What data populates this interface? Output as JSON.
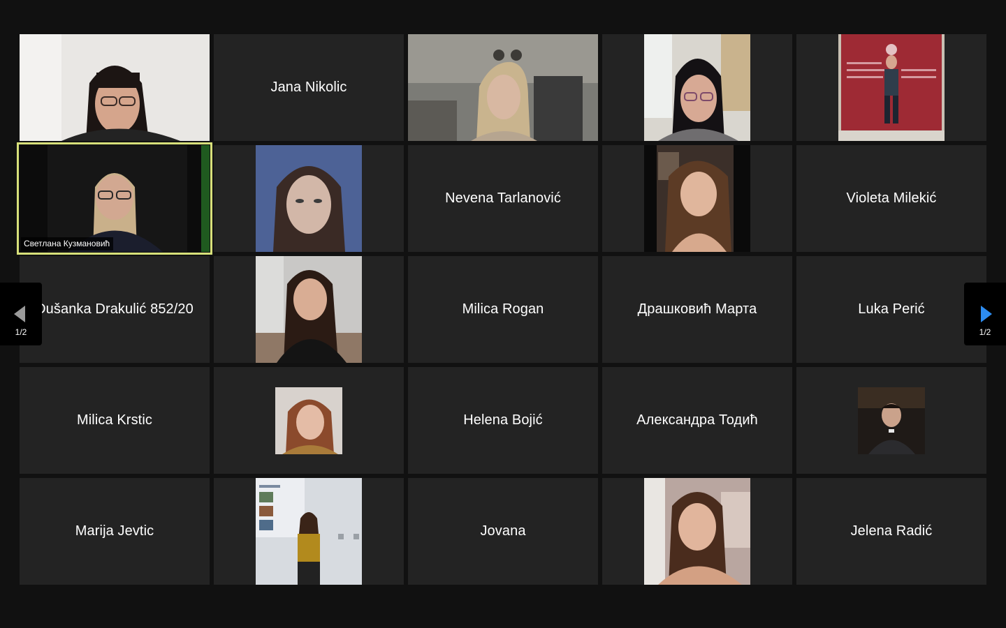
{
  "participants": [
    {
      "name": "",
      "type": "video"
    },
    {
      "name": "Jana Nikolic",
      "type": "name"
    },
    {
      "name": "",
      "type": "video"
    },
    {
      "name": "",
      "type": "photo"
    },
    {
      "name": "",
      "type": "photo"
    },
    {
      "name": "Светлана Кузмановић",
      "type": "video",
      "active": true
    },
    {
      "name": "",
      "type": "photo"
    },
    {
      "name": "Nevena Tarlanović",
      "type": "name"
    },
    {
      "name": "",
      "type": "photo"
    },
    {
      "name": "Violeta Milekić",
      "type": "name"
    },
    {
      "name": "Dušanka Drakulić 852/20",
      "type": "name"
    },
    {
      "name": "",
      "type": "photo"
    },
    {
      "name": "Milica Rogan",
      "type": "name"
    },
    {
      "name": "Драшковић Марта",
      "type": "name"
    },
    {
      "name": "Luka Perić",
      "type": "name"
    },
    {
      "name": "Milica Krstic",
      "type": "name"
    },
    {
      "name": "",
      "type": "photo"
    },
    {
      "name": "Helena Bojić",
      "type": "name"
    },
    {
      "name": "Александра Тодић",
      "type": "name"
    },
    {
      "name": "",
      "type": "photo"
    },
    {
      "name": "Marija Jevtic",
      "type": "name"
    },
    {
      "name": "",
      "type": "photo"
    },
    {
      "name": "Jovana",
      "type": "name"
    },
    {
      "name": "",
      "type": "photo"
    },
    {
      "name": "Jelena Radić",
      "type": "name"
    }
  ],
  "pagination": {
    "prev_label": "1/2",
    "next_label": "1/2",
    "prev_icon": "arrow-left-icon",
    "next_icon": "arrow-right-icon"
  },
  "colors": {
    "background": "#111111",
    "tile": "#232323",
    "active_speaker_border": "#d7e07a",
    "next_arrow": "#2d8cf0"
  }
}
